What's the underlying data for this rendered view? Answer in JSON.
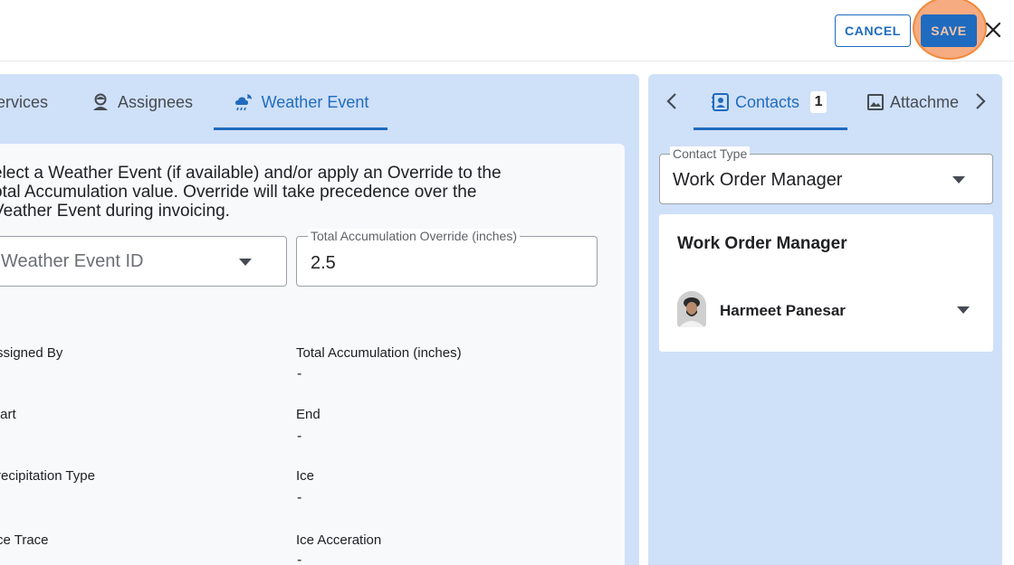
{
  "header": {
    "cancel_label": "CANCEL",
    "save_label": "SAVE",
    "close_icon": "close-icon"
  },
  "left_tabs": [
    {
      "label": "ervices",
      "icon": "services-icon"
    },
    {
      "label": "Assignees",
      "icon": "assignee-icon"
    },
    {
      "label": "Weather Event",
      "icon": "weather-icon",
      "active": true
    }
  ],
  "weather": {
    "description_lines": [
      "elect a Weather Event (if available) and/or apply an Override to the",
      "otal Accumulation value. Override will take precedence over the",
      "Veather Event during invoicing."
    ],
    "event_select_value": "Weather Event ID",
    "override_label": "Total Accumulation Override (inches)",
    "override_value": "2.5",
    "details": {
      "assigned_by_label": "ssigned By",
      "total_accumulation_label": "Total Accumulation (inches)",
      "total_accumulation_value": "-",
      "start_label": "tart",
      "end_label": "End",
      "end_value": "-",
      "precip_type_label": "recipitation Type",
      "ice_label": "Ice",
      "ice_value": "-",
      "ice_trace_label": "ce Trace",
      "ice_acceration_label": "Ice Acceration",
      "ice_acceration_value": "-"
    }
  },
  "right_tabs": [
    {
      "label": "Contacts",
      "icon": "contacts-icon",
      "count": "1",
      "active": true
    },
    {
      "label": "Attachme",
      "icon": "image-icon"
    }
  ],
  "contacts": {
    "contact_type_label": "Contact Type",
    "contact_type_value": "Work Order Manager",
    "card_title": "Work Order Manager",
    "person_name": "Harmeet Panesar"
  },
  "colors": {
    "accent": "#1f6bbf",
    "panel_bg": "#cfe0f9",
    "save_highlight": "#f08a3c"
  }
}
